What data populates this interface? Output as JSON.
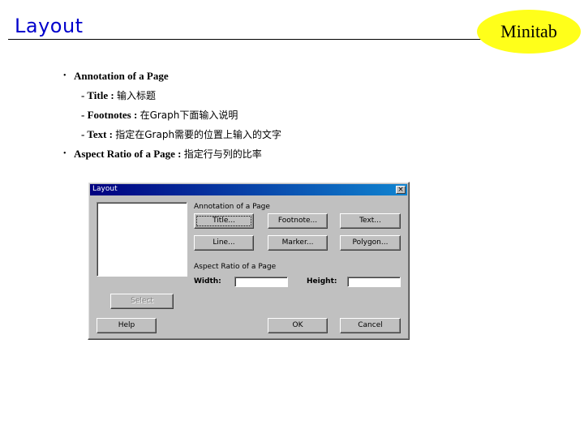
{
  "slide": {
    "title": "Layout",
    "brand": "Minitab"
  },
  "bullets": [
    {
      "label": "Annotation of a Page",
      "subs": [
        {
          "label": "- Title : ",
          "text": "输入标题"
        },
        {
          "label": "- Footnotes : ",
          "text": "在Graph下面输入说明"
        },
        {
          "label": "- Text : ",
          "text": "指定在Graph需要的位置上输入的文字"
        }
      ]
    },
    {
      "label": "Aspect Ratio of a Page : ",
      "text": "指定行与列的比率"
    }
  ],
  "dialog": {
    "title": "Layout",
    "close": "×",
    "annotation_group": "Annotation of a Page",
    "buttons": {
      "title": "Title...",
      "footnote": "Footnote...",
      "text": "Text...",
      "line": "Line...",
      "marker": "Marker...",
      "polygon": "Polygon...",
      "select": "Select",
      "help": "Help",
      "ok": "OK",
      "cancel": "Cancel"
    },
    "aspect_group": "Aspect Ratio of a Page",
    "width_label": "Width:",
    "height_label": "Height:",
    "width_value": "",
    "height_value": ""
  }
}
